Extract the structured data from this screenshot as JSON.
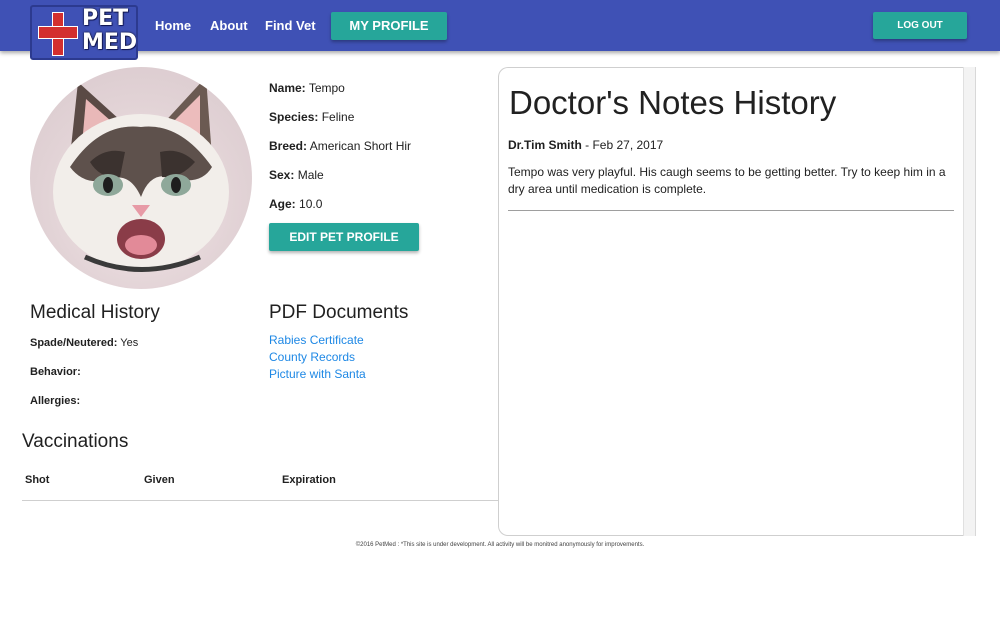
{
  "nav": {
    "logo_line1": "PET",
    "logo_line2": "MED",
    "links": [
      "Home",
      "About",
      "Find Vet"
    ],
    "profile_button": "MY PROFILE",
    "logout_button": "LOG OUT"
  },
  "pet": {
    "name_label": "Name:",
    "name": "Tempo",
    "species_label": "Species:",
    "species": "Feline",
    "breed_label": "Breed:",
    "breed": "American Short Hir",
    "sex_label": "Sex:",
    "sex": "Male",
    "age_label": "Age:",
    "age": "10.0",
    "edit_button": "EDIT PET PROFILE"
  },
  "medical": {
    "title": "Medical History",
    "spayed_label": "Spade/Neutered:",
    "spayed": "Yes",
    "behavior_label": "Behavior:",
    "behavior": "",
    "allergies_label": "Allergies:",
    "allergies": ""
  },
  "pdf": {
    "title": "PDF Documents",
    "links": [
      "Rabies Certificate",
      "County Records",
      "Picture with Santa"
    ]
  },
  "vaccinations": {
    "title": "Vaccinations",
    "columns": [
      "Shot",
      "Given",
      "Expiration"
    ]
  },
  "notes": {
    "title": "Doctor's Notes History",
    "entries": [
      {
        "doctor": "Dr.Tim Smith",
        "date": " - Feb 27, 2017",
        "text": "Tempo was very playful. His caugh seems to be getting better. Try to keep him in a dry area until medication is complete."
      }
    ]
  },
  "footer": "©2016 PetMed : *This site is under development. All activity will be monitred anonymously for improvements.",
  "colors": {
    "navbar": "#3f51b5",
    "button": "#26a69a",
    "link": "#1e88e5"
  }
}
